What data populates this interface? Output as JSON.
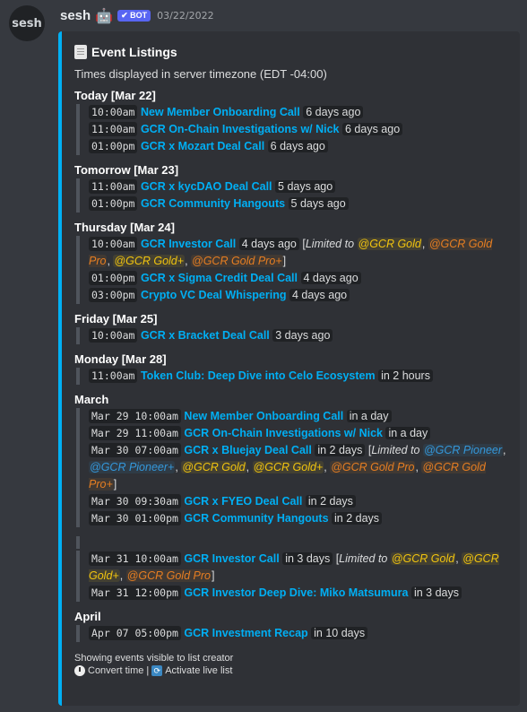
{
  "message": {
    "avatar_text": "sesh",
    "username": "sesh",
    "bot_badge": "✔ BOT",
    "timestamp": "03/22/2022"
  },
  "embed": {
    "title": "Event Listings",
    "timezone_note": "Times displayed in server timezone (EDT -04:00)",
    "sections": [
      {
        "title": "Today [Mar 22]",
        "events": [
          {
            "time": "10:00am",
            "name": "New Member Onboarding Call",
            "relative": "6 days ago"
          },
          {
            "time": "11:00am",
            "name": "GCR On-Chain Investigations w/ Nick",
            "relative": "6 days ago"
          },
          {
            "time": "01:00pm",
            "name": "GCR x Mozart Deal Call",
            "relative": "6 days ago"
          }
        ]
      },
      {
        "title": "Tomorrow [Mar 23]",
        "events": [
          {
            "time": "11:00am",
            "name": "GCR x kycDAO Deal Call",
            "relative": "5 days ago"
          },
          {
            "time": "01:00pm",
            "name": "GCR Community Hangouts",
            "relative": "5 days ago"
          }
        ]
      },
      {
        "title": "Thursday [Mar 24]",
        "events": [
          {
            "time": "10:00am",
            "name": "GCR Investor Call",
            "relative": "4 days ago",
            "limited_label": "Limited to",
            "roles": [
              {
                "text": "@GCR Gold",
                "color": "#f1c40f"
              },
              {
                "text": "@GCR Gold Pro",
                "color": "#e67e22"
              },
              {
                "text": "@GCR Gold+",
                "color": "#f1c40f"
              },
              {
                "text": "@GCR Gold Pro+",
                "color": "#e67e22"
              }
            ]
          },
          {
            "time": "01:00pm",
            "name": "GCR x Sigma Credit Deal Call",
            "relative": "4 days ago"
          },
          {
            "time": "03:00pm",
            "name": "Crypto VC Deal Whispering",
            "relative": "4 days ago"
          }
        ]
      },
      {
        "title": "Friday [Mar 25]",
        "events": [
          {
            "time": "10:00am",
            "name": "GCR x Bracket Deal Call",
            "relative": "3 days ago"
          }
        ]
      },
      {
        "title": "Monday [Mar 28]",
        "events": [
          {
            "time": "11:00am",
            "name": "Token Club: Deep Dive into Celo Ecosystem",
            "relative": "in 2 hours"
          }
        ]
      },
      {
        "title": "March",
        "events": [
          {
            "time": "Mar 29 10:00am",
            "name": "New Member Onboarding Call",
            "relative": "in a day"
          },
          {
            "time": "Mar 29 11:00am",
            "name": "GCR On-Chain Investigations w/ Nick",
            "relative": "in a day"
          },
          {
            "time": "Mar 30 07:00am",
            "name": "GCR x Bluejay Deal Call",
            "relative": "in 2 days",
            "limited_label": "Limited to",
            "roles": [
              {
                "text": "@GCR Pioneer",
                "color": "#3498db"
              },
              {
                "text": "@GCR Pioneer+",
                "color": "#3498db"
              },
              {
                "text": "@GCR Gold",
                "color": "#f1c40f"
              },
              {
                "text": "@GCR Gold+",
                "color": "#f1c40f"
              },
              {
                "text": "@GCR Gold Pro",
                "color": "#e67e22"
              },
              {
                "text": "@GCR Gold Pro+",
                "color": "#e67e22"
              }
            ]
          },
          {
            "time": "Mar 30 09:30am",
            "name": "GCR x FYEO Deal Call",
            "relative": "in 2 days"
          },
          {
            "time": "Mar 30 01:00pm",
            "name": "GCR Community Hangouts",
            "relative": "in 2 days"
          }
        ]
      },
      {
        "title": "",
        "events": [
          {
            "time": "Mar 31 10:00am",
            "name": "GCR Investor Call",
            "relative": "in 3 days",
            "limited_label": "Limited to",
            "roles": [
              {
                "text": "@GCR Gold",
                "color": "#f1c40f"
              },
              {
                "text": "@GCR Gold+",
                "color": "#f1c40f"
              },
              {
                "text": "@GCR Gold Pro",
                "color": "#e67e22"
              }
            ]
          },
          {
            "time": "Mar 31 12:00pm",
            "name": "GCR Investor Deep Dive: Miko Matsumura",
            "relative": "in 3 days"
          }
        ]
      },
      {
        "title": "April",
        "events": [
          {
            "time": "Apr 07 05:00pm",
            "name": "GCR Investment Recap",
            "relative": "in 10 days"
          }
        ]
      }
    ],
    "footer": {
      "line1": "Showing events visible to list creator",
      "convert_time": "Convert time",
      "separator": "|",
      "activate_live": "Activate live list"
    }
  },
  "icons": {
    "title_icon": "memo-icon",
    "convert_icon": "clock-icon",
    "live_icon": "refresh-icon"
  },
  "colors": {
    "accent": "#00b0f4",
    "link": "#00aff4",
    "gold": "#f1c40f",
    "orange": "#e67e22",
    "blue": "#3498db"
  }
}
